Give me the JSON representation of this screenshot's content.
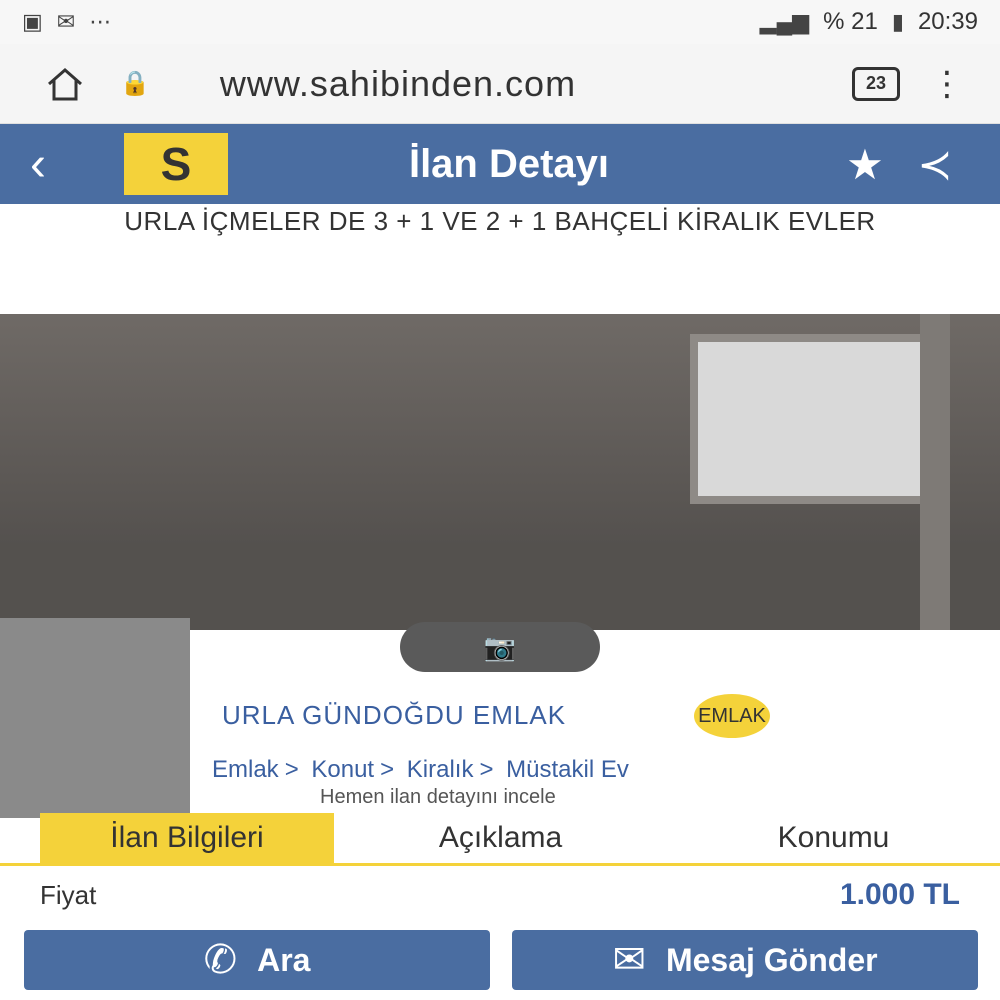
{
  "status_bar": {
    "left_icons": [
      "sim-icon",
      "message-icon",
      "dots-icon"
    ],
    "battery": "% 21",
    "time": "20:39"
  },
  "browser": {
    "url": "www.sahibinden.com",
    "tab_count": "23"
  },
  "header": {
    "logo_text": "S",
    "title": "İlan Detayı"
  },
  "listing": {
    "title": "URLA İÇMELER DE 3 + 1 VE 2 + 1 BAHÇELİ KİRALIK EVLER"
  },
  "seller": {
    "name": "URLA GÜNDOĞDU EMLAK",
    "badge_text": "EMLAK",
    "category": [
      "Emlak",
      "Konut",
      "Kiralık",
      "Müstakil Ev"
    ],
    "subtext": "Hemen ilan detayını incele"
  },
  "tabs": [
    {
      "label": "İlan Bilgileri",
      "active": true
    },
    {
      "label": "Açıklama",
      "active": false
    },
    {
      "label": "Konumu",
      "active": false
    }
  ],
  "price": {
    "label": "Fiyat",
    "value": "1.000 TL"
  },
  "actions": {
    "call_label": "Ara",
    "message_label": "Mesaj Gönder"
  },
  "colors": {
    "header_blue": "#4a6da1",
    "brand_yellow": "#f4d23a",
    "link_blue": "#3a5fa0"
  }
}
